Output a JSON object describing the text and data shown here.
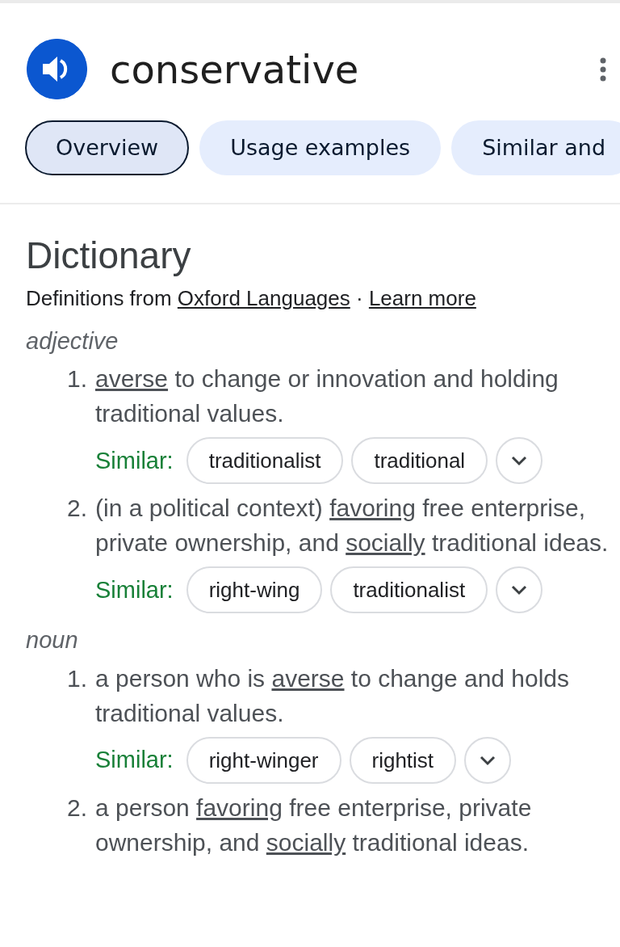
{
  "header": {
    "title": "conservative"
  },
  "tabs": [
    {
      "label": "Overview",
      "selected": true
    },
    {
      "label": "Usage examples",
      "selected": false
    },
    {
      "label": "Similar and",
      "selected": false
    }
  ],
  "dictionary": {
    "heading": "Dictionary",
    "source_prefix": "Definitions from",
    "source_link": "Oxford Languages",
    "separator": "·",
    "learn_more": "Learn more"
  },
  "senses": [
    {
      "part_of_speech": "adjective",
      "definitions": [
        {
          "number": "1.",
          "segments": [
            {
              "text": "averse",
              "link": true
            },
            {
              "text": " to change or innovation and holding traditional values.",
              "link": false
            }
          ],
          "similar_label": "Similar:",
          "similar": [
            "traditionalist",
            "traditional"
          ]
        },
        {
          "number": "2.",
          "segments": [
            {
              "text": "(in a political context) ",
              "link": false
            },
            {
              "text": "favoring",
              "link": true
            },
            {
              "text": " free enterprise, private ownership, and ",
              "link": false
            },
            {
              "text": "socially",
              "link": true
            },
            {
              "text": " traditional ideas.",
              "link": false
            }
          ],
          "similar_label": "Similar:",
          "similar": [
            "right-wing",
            "traditionalist"
          ]
        }
      ]
    },
    {
      "part_of_speech": "noun",
      "definitions": [
        {
          "number": "1.",
          "segments": [
            {
              "text": "a person who is ",
              "link": false
            },
            {
              "text": "averse",
              "link": true
            },
            {
              "text": " to change and holds traditional values.",
              "link": false
            }
          ],
          "similar_label": "Similar:",
          "similar": [
            "right-winger",
            "rightist"
          ]
        },
        {
          "number": "2.",
          "segments": [
            {
              "text": "a person ",
              "link": false
            },
            {
              "text": "favoring",
              "link": true
            },
            {
              "text": " free enterprise, private ownership, and ",
              "link": false
            },
            {
              "text": "socially",
              "link": true
            },
            {
              "text": " traditional ideas.",
              "link": false
            }
          ]
        }
      ]
    }
  ]
}
